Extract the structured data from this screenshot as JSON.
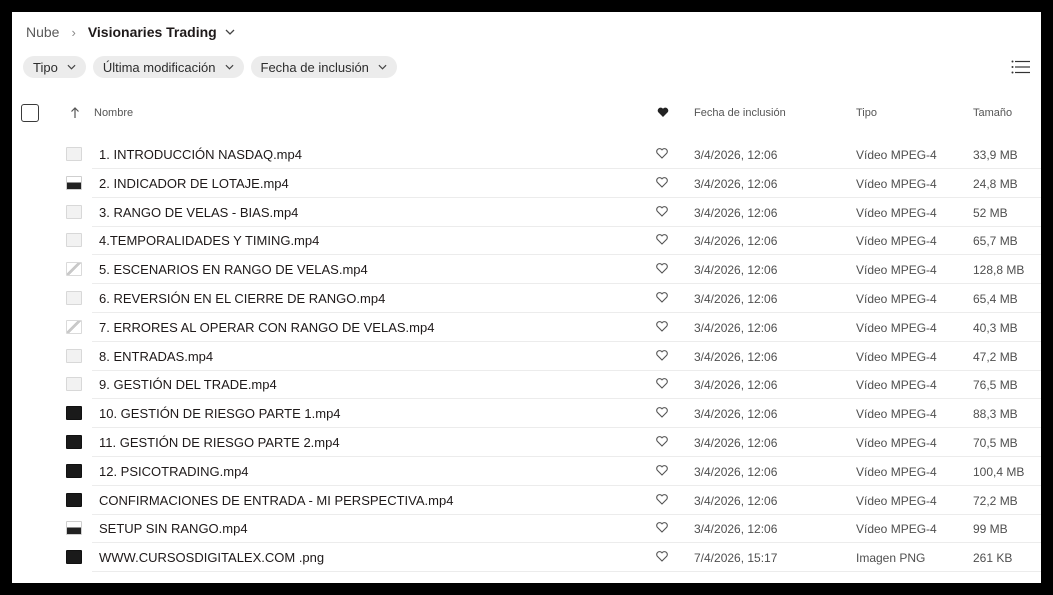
{
  "breadcrumb": {
    "root": "Nube",
    "current": "Visionaries Trading"
  },
  "filters": {
    "type": "Tipo",
    "modified": "Última modificación",
    "added": "Fecha de inclusión"
  },
  "columns": {
    "name": "Nombre",
    "date": "Fecha de inclusión",
    "type": "Tipo",
    "size": "Tamaño"
  },
  "colors": {
    "accent_dark": "#1e1919",
    "chip_bg": "#ececec",
    "divider": "#ececec"
  },
  "files": [
    {
      "name": "1. INTRODUCCIÓN NASDAQ.mp4",
      "date": "3/4/2026, 12:06",
      "type": "Vídeo MPEG-4",
      "size": "33,9 MB",
      "thumb": "light"
    },
    {
      "name": "2. INDICADOR DE LOTAJE.mp4",
      "date": "3/4/2026, 12:06",
      "type": "Vídeo MPEG-4",
      "size": "24,8 MB",
      "thumb": "mixed"
    },
    {
      "name": "3. RANGO DE VELAS - BIAS.mp4",
      "date": "3/4/2026, 12:06",
      "type": "Vídeo MPEG-4",
      "size": "52 MB",
      "thumb": "light"
    },
    {
      "name": "4.TEMPORALIDADES Y TIMING.mp4",
      "date": "3/4/2026, 12:06",
      "type": "Vídeo MPEG-4",
      "size": "65,7 MB",
      "thumb": "light"
    },
    {
      "name": "5. ESCENARIOS EN RANGO DE VELAS.mp4",
      "date": "3/4/2026, 12:06",
      "type": "Vídeo MPEG-4",
      "size": "128,8 MB",
      "thumb": "chart"
    },
    {
      "name": "6. REVERSIÓN EN EL CIERRE DE RANGO.mp4",
      "date": "3/4/2026, 12:06",
      "type": "Vídeo MPEG-4",
      "size": "65,4 MB",
      "thumb": "light"
    },
    {
      "name": "7. ERRORES AL OPERAR CON RANGO DE VELAS.mp4",
      "date": "3/4/2026, 12:06",
      "type": "Vídeo MPEG-4",
      "size": "40,3 MB",
      "thumb": "chart"
    },
    {
      "name": "8. ENTRADAS.mp4",
      "date": "3/4/2026, 12:06",
      "type": "Vídeo MPEG-4",
      "size": "47,2 MB",
      "thumb": "light"
    },
    {
      "name": "9. GESTIÓN DEL TRADE.mp4",
      "date": "3/4/2026, 12:06",
      "type": "Vídeo MPEG-4",
      "size": "76,5 MB",
      "thumb": "light"
    },
    {
      "name": "10. GESTIÓN DE RIESGO PARTE 1.mp4",
      "date": "3/4/2026, 12:06",
      "type": "Vídeo MPEG-4",
      "size": "88,3 MB",
      "thumb": "dark"
    },
    {
      "name": "11. GESTIÓN DE RIESGO PARTE 2.mp4",
      "date": "3/4/2026, 12:06",
      "type": "Vídeo MPEG-4",
      "size": "70,5 MB",
      "thumb": "dark"
    },
    {
      "name": "12. PSICOTRADING.mp4",
      "date": "3/4/2026, 12:06",
      "type": "Vídeo MPEG-4",
      "size": "100,4 MB",
      "thumb": "dark"
    },
    {
      "name": "CONFIRMACIONES DE ENTRADA - MI PERSPECTIVA.mp4",
      "date": "3/4/2026, 12:06",
      "type": "Vídeo MPEG-4",
      "size": "72,2 MB",
      "thumb": "dark"
    },
    {
      "name": "SETUP SIN RANGO.mp4",
      "date": "3/4/2026, 12:06",
      "type": "Vídeo MPEG-4",
      "size": "99 MB",
      "thumb": "mixed"
    },
    {
      "name": "WWW.CURSOSDIGITALEX.COM .png",
      "date": "7/4/2026, 15:17",
      "type": "Imagen PNG",
      "size": "261 KB",
      "thumb": "dark"
    }
  ]
}
